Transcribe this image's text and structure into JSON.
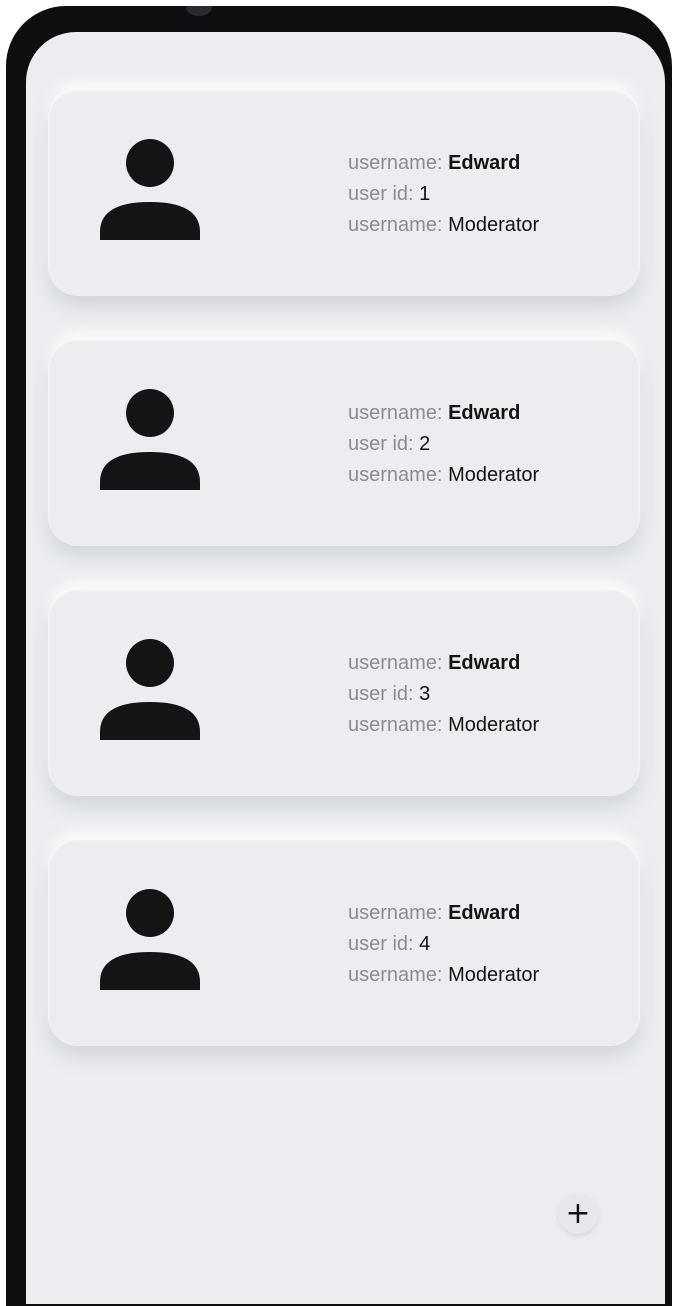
{
  "users": [
    {
      "name_label": "username:",
      "name": "Edward",
      "id_label": "user id:",
      "id": "1",
      "role_label": "username:",
      "role": "Moderator",
      "avatar_icon": "person-icon"
    },
    {
      "name_label": "username:",
      "name": "Edward",
      "id_label": "user id:",
      "id": "2",
      "role_label": "username:",
      "role": "Moderator",
      "avatar_icon": "person-icon"
    },
    {
      "name_label": "username:",
      "name": "Edward",
      "id_label": "user id:",
      "id": "3",
      "role_label": "username:",
      "role": "Moderator",
      "avatar_icon": "person-icon"
    },
    {
      "name_label": "username:",
      "name": "Edward",
      "id_label": "user id:",
      "id": "4",
      "role_label": "username:",
      "role": "Moderator",
      "avatar_icon": "person-icon"
    }
  ],
  "fab": {
    "icon": "plus-icon",
    "glyph": "+"
  },
  "colors": {
    "background": "#ebedf0",
    "frame": "#0e0e10",
    "text": "#141414",
    "label": "#8a8c90"
  }
}
